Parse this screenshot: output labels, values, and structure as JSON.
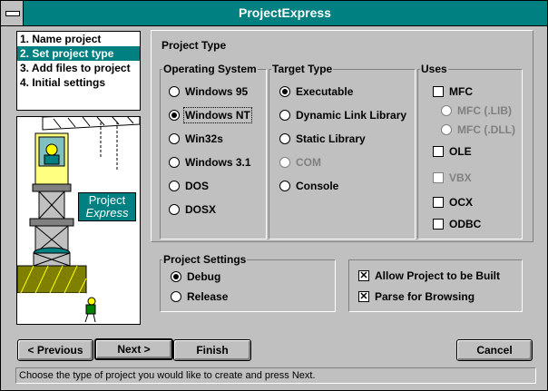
{
  "window": {
    "title": "ProjectExpress"
  },
  "steps": [
    {
      "label": "1. Name project",
      "selected": false
    },
    {
      "label": "2. Set project type",
      "selected": true
    },
    {
      "label": "3. Add files to project",
      "selected": false
    },
    {
      "label": "4. Initial settings",
      "selected": false
    }
  ],
  "illustration": {
    "logo_line1": "Project",
    "logo_line2": "Express"
  },
  "project_type": {
    "heading": "Project Type",
    "operating_system": {
      "title": "Operating System",
      "options": [
        "Windows 95",
        "Windows NT",
        "Win32s",
        "Windows 3.1",
        "DOS",
        "DOSX"
      ],
      "selected": "Windows NT"
    },
    "target_type": {
      "title": "Target Type",
      "options": [
        "Executable",
        "Dynamic Link Library",
        "Static Library",
        "COM",
        "Console"
      ],
      "selected": "Executable",
      "disabled": [
        "COM"
      ]
    },
    "uses": {
      "title": "Uses",
      "mfc": "MFC",
      "mfc_lib": "MFC (.LIB)",
      "mfc_dll": "MFC (.DLL)",
      "ole": "OLE",
      "vbx": "VBX",
      "ocx": "OCX",
      "odbc": "ODBC"
    }
  },
  "project_settings": {
    "title": "Project Settings",
    "debug": "Debug",
    "release": "Release",
    "selected": "Debug"
  },
  "build_options": {
    "allow_built": "Allow Project to be Built",
    "parse_browsing": "Parse for Browsing",
    "allow_built_checked": true,
    "parse_browsing_checked": true
  },
  "buttons": {
    "previous": "< Previous",
    "next": "Next >",
    "finish": "Finish",
    "cancel": "Cancel"
  },
  "status": {
    "text": "Choose the type of project you would like to create and press Next."
  },
  "colors": {
    "titlebar": "#008080",
    "face": "#c0c0c0",
    "selection": "#008080"
  }
}
